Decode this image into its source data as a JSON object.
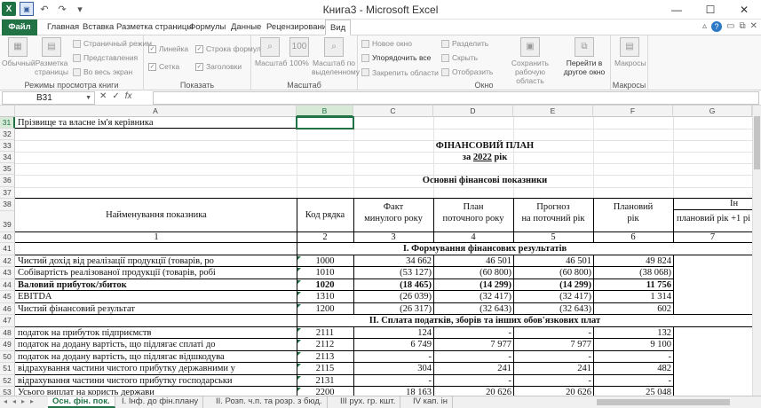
{
  "window": {
    "title": "Книга3  -  Microsoft Excel",
    "min": "—",
    "max": "☐",
    "close": "✕"
  },
  "qat": {
    "logo": "X",
    "save": "💾",
    "undo": "↶",
    "redo": "↷",
    "more": "▾"
  },
  "tabs": [
    "Файл",
    "Главная",
    "Вставка",
    "Разметка страницы",
    "Формулы",
    "Данные",
    "Рецензирование",
    "Вид"
  ],
  "ribbon": {
    "view_modes": {
      "label": "Режимы просмотра книги",
      "normal": "Обычный",
      "page_layout": "Разметка страницы",
      "page_break": "Страничный режим",
      "custom_views": "Представления",
      "full_screen": "Во весь экран"
    },
    "show": {
      "label": "Показать",
      "ruler": "Линейка",
      "formula_bar": "Строка формул",
      "gridlines": "Сетка",
      "headings": "Заголовки"
    },
    "zoom": {
      "label": "Масштаб",
      "zoom": "Масштаб",
      "zoom100": "100%",
      "zoom_sel": "Масштаб по выделенному"
    },
    "window": {
      "label": "Окно",
      "new_window": "Новое окно",
      "arrange_all": "Упорядочить все",
      "freeze": "Закрепить области",
      "split": "Разделить",
      "hide": "Скрыть",
      "unhide": "Отобразить",
      "save_ws": "Сохранить рабочую область",
      "switch": "Перейти в другое окно"
    },
    "macros": {
      "label": "Макросы",
      "macros": "Макросы"
    }
  },
  "formula_bar": {
    "name_box": "B31",
    "cancel": "✕",
    "enter": "✓",
    "fx": "fx",
    "value": ""
  },
  "columns": [
    "A",
    "B",
    "C",
    "D",
    "E",
    "F",
    "G"
  ],
  "rows": [
    "31",
    "32",
    "33",
    "34",
    "35",
    "36",
    "37",
    "38",
    "39",
    "40",
    "41",
    "42",
    "43",
    "44",
    "45",
    "46",
    "47",
    "48",
    "49",
    "50",
    "51",
    "52",
    "53"
  ],
  "sheet": {
    "r31_a": "Прізвище та власне ім'я керівника",
    "title": "ФІНАНСОВИЙ ПЛАН",
    "subtitle_pre": "за ",
    "subtitle_year": "2022",
    "subtitle_post": " рік",
    "section_title": "Основні фінансові показники",
    "hdr_name": "Найменування показника",
    "hdr_code": "Код рядка",
    "hdr_fact_1": "Факт",
    "hdr_fact_2": "минулого року",
    "hdr_plan_1": "План",
    "hdr_plan_2": "поточного року",
    "hdr_forecast_1": "Прогноз",
    "hdr_forecast_2": "на поточний рік",
    "hdr_planned_1": "Плановий",
    "hdr_planned_2": "рік",
    "hdr_g_top": "Ін",
    "hdr_g_bottom": "плановий рік +1 рі",
    "nums": [
      "1",
      "2",
      "3",
      "4",
      "5",
      "6",
      "7"
    ],
    "sec1": "I. Формування фінансових результатів",
    "sec2": "II. Сплата податків, зборів та інших обов'язкових плат"
  },
  "data_rows": [
    {
      "name": "Чистий дохід від реалізації продукції (товарів, ро",
      "code": "1000",
      "fact": "34 662",
      "plan": "46 501",
      "forecast": "46 501",
      "planned": "49 824",
      "bold": false
    },
    {
      "name": "Собівартість реалізованої продукції (товарів, робі",
      "code": "1010",
      "fact": "(53 127)",
      "plan": "(60 800)",
      "forecast": "(60 800)",
      "planned": "(38 068)",
      "bold": false
    },
    {
      "name": "Валовий прибуток/збиток",
      "code": "1020",
      "fact": "(18 465)",
      "plan": "(14 299)",
      "forecast": "(14 299)",
      "planned": "11 756",
      "bold": true
    },
    {
      "name": "EBITDA",
      "code": "1310",
      "fact": "(26 039)",
      "plan": "(32 417)",
      "forecast": "(32 417)",
      "planned": "1 314",
      "bold": false
    },
    {
      "name": "Чистий фінансовий результат",
      "code": "1200",
      "fact": "(26 317)",
      "plan": "(32 643)",
      "forecast": "(32 643)",
      "planned": "602",
      "bold": false
    },
    {
      "name": "податок на прибуток підприємств",
      "code": "2111",
      "fact": "124",
      "plan": "-",
      "forecast": "-",
      "planned": "132",
      "bold": false
    },
    {
      "name": "податок на додану вартість, що підлягає сплаті до",
      "code": "2112",
      "fact": "6 749",
      "plan": "7 977",
      "forecast": "7 977",
      "planned": "9 100",
      "bold": false
    },
    {
      "name": "податок на додану вартість, що підлягає відшкодува",
      "code": "2113",
      "fact": "-",
      "plan": "-",
      "forecast": "-",
      "planned": "-",
      "bold": false
    },
    {
      "name": "відрахування частини чистого прибутку державними у",
      "code": "2115",
      "fact": "304",
      "plan": "241",
      "forecast": "241",
      "planned": "482",
      "bold": false
    },
    {
      "name": "відрахування частини чистого прибутку господарськи",
      "code": "2131",
      "fact": "-",
      "plan": "-",
      "forecast": "-",
      "planned": "-",
      "bold": false
    },
    {
      "name": "Усього виплат на користь держави",
      "code": "2200",
      "fact": "18 163",
      "plan": "20 626",
      "forecast": "20 626",
      "planned": "25 048",
      "bold": false
    }
  ],
  "sheet_tabs": [
    "Осн. фін. пок.",
    "I. Інф. до фін.плану",
    "II. Розп. ч.п. та розр. з бюд.",
    "III рух. гр. кшт.",
    "IV кап. ін"
  ],
  "sheet_nav": [
    "◂",
    "◂",
    "▸",
    "▸"
  ],
  "ui_colors": {
    "accent": "#217346",
    "selection": "#d7e9d7"
  }
}
